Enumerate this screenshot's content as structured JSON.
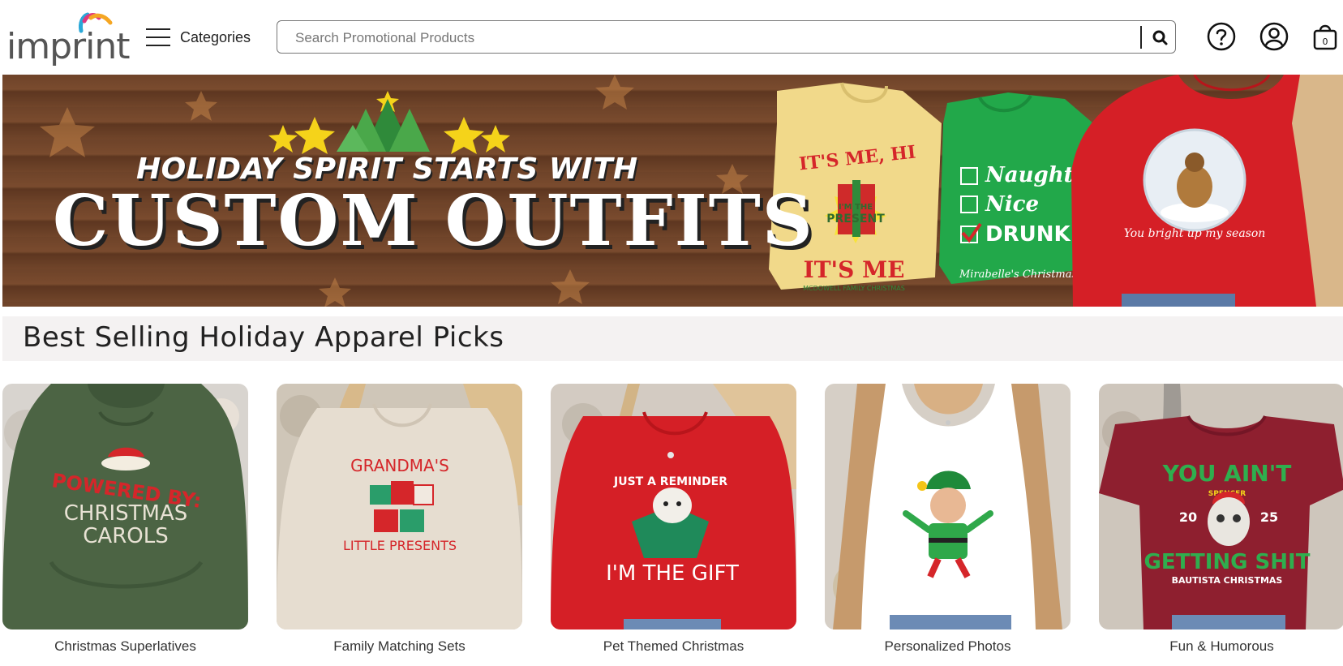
{
  "header": {
    "logo_text": "imprint",
    "categories_label": "Categories",
    "search_placeholder": "Search Promotional Products",
    "icons": [
      "help-icon",
      "account-icon",
      "cart-icon"
    ],
    "cart_count": "0"
  },
  "banner": {
    "line1": "HOLIDAY SPIRIT STARTS WITH",
    "line2": "CUSTOM OUTFITS",
    "shirt1": {
      "top": "IT'S ME, HI",
      "mid": "I'M THE",
      "mid2": "PRESENT",
      "bottom": "IT'S ME",
      "foot": "MCDOWELL FAMILY CHRISTMAS"
    },
    "shirt2": {
      "opt1": "Naughty",
      "opt2": "Nice",
      "opt3": "DRUNK",
      "foot": "Mirabelle's Christmas P"
    },
    "shirt3": {
      "text": "You bright up my season"
    }
  },
  "section": {
    "title": "Best Selling Holiday Apparel Picks"
  },
  "products": [
    {
      "label": "Christmas Superlatives",
      "print": [
        "POWERED BY:",
        "CHRISTMAS",
        "CAROLS"
      ],
      "garment": "#4c6444"
    },
    {
      "label": "Family Matching Sets",
      "print": [
        "GRANDMA'S",
        "LITTLE PRESENTS"
      ],
      "garment": "#e6ddd0"
    },
    {
      "label": "Pet Themed Christmas",
      "print": [
        "JUST A REMINDER",
        "I'M THE GIFT"
      ],
      "garment": "#d51f26"
    },
    {
      "label": "Personalized Photos",
      "print": [],
      "garment": "#ffffff"
    },
    {
      "label": "Fun & Humorous",
      "print": [
        "YOU AIN'T",
        "SPENCER",
        "20",
        "25",
        "GETTING SHIT",
        "BAUTISTA CHRISTMAS"
      ],
      "garment": "#8e1f2f"
    }
  ],
  "colors": {
    "accent_red": "#d51f26",
    "accent_green": "#2fae4e",
    "wood": "#6e4329"
  }
}
